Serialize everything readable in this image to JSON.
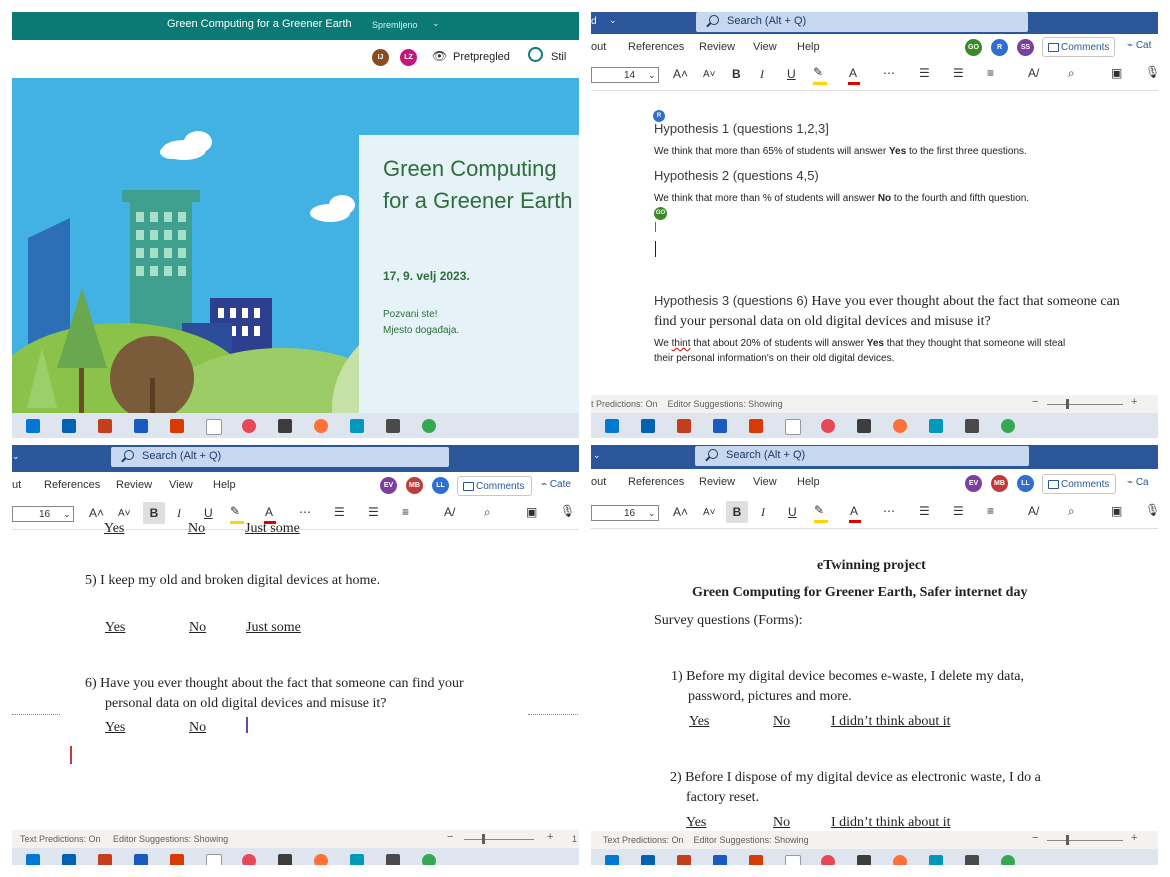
{
  "q1": {
    "header": {
      "title": "Green Computing for a Greener Earth",
      "status": "Spremljeno",
      "avatars": [
        "IJ",
        "LZ"
      ],
      "preview": "Pretpregled",
      "style": "Stil"
    },
    "card": {
      "title": "Green Computing for a Greener Earth",
      "date": "17, 9. velj 2023.",
      "invite": "Pozvani ste!",
      "place": "Mjesto događaja."
    },
    "colors": {
      "header": "#0b7a75",
      "sky": "#42b1e3",
      "card": "#e5f3f9"
    }
  },
  "q2": {
    "search": "Search (Alt + Q)",
    "menu": [
      "out",
      "References",
      "Review",
      "View",
      "Help"
    ],
    "avatars": [
      "GO",
      "R",
      "SS"
    ],
    "comments": "Comments",
    "extra": "Cat",
    "font_size": "14",
    "doc": {
      "h1": "Hypothesis 1 (questions 1,2,3]",
      "p1_pre": "We think that more than 65% of students will answer ",
      "p1_bold": "Yes",
      "p1_post": " to the first three questions.",
      "h2": "Hypothesis 2 (questions 4,5)",
      "p2_pre": "We think that more than % of students will answer ",
      "p2_bold": "No",
      "p2_post": " to the fourth and fifth question.",
      "h3_a": "Hypothesis 3 (questions 6) ",
      "h3_b": "Have you ever thought about the fact that someone can",
      "h3_c": "find your personal data on old digital devices and misuse it?",
      "p3_a_pre": "We ",
      "p3_a_err": "thint",
      "p3_a_post": " that about 20% of students will answer ",
      "p3_a_bold": "Yes",
      "p3_a_end": " that they thought that someone will steal",
      "p3_b": "their personal information's on their old digital devices."
    },
    "status": "t Predictions: On    Editor Suggestions: Showing"
  },
  "q3": {
    "search": "Search (Alt + Q)",
    "menu": [
      "ut",
      "References",
      "Review",
      "View",
      "Help"
    ],
    "avatars": [
      "EV",
      "MB",
      "LL"
    ],
    "comments": "Comments",
    "extra": "Cate",
    "font_size": "16",
    "doc": {
      "cut": [
        "Yes",
        "No",
        "Just some"
      ],
      "q5": "5) I keep my old and broken digital devices at home.",
      "q5_answers": [
        "Yes",
        "No",
        "Just some"
      ],
      "q6_a": "6) Have you ever thought about the fact that someone can find your",
      "q6_b": "personal data on old digital devices and misuse it?",
      "q6_answers": [
        "Yes",
        "No"
      ]
    },
    "status": "Text Predictions: On     Editor Suggestions: Showing",
    "status_right": "1"
  },
  "q4": {
    "search": "Search (Alt + Q)",
    "menu": [
      "out",
      "References",
      "Review",
      "View",
      "Help"
    ],
    "avatars": [
      "EV",
      "MB",
      "LL"
    ],
    "comments": "Comments",
    "extra": "Ca",
    "font_size": "16",
    "doc": {
      "title": "eTwinning project",
      "subtitle": "Green Computing for Greener Earth, Safer internet day",
      "survey": "Survey questions (Forms):",
      "q1_a": "1) Before my digital device becomes e-waste, I delete my data,",
      "q1_b": "password, pictures and more.",
      "q1_answers": [
        "Yes",
        "No",
        "I didn’t think about it"
      ],
      "q2_a": "2) Before I dispose of my digital device as electronic waste, I do a",
      "q2_b": "factory reset.",
      "q2_answers": [
        "Yes",
        "No",
        "I didn’t think about it"
      ]
    },
    "status": "Text Predictions: On    Editor Suggestions: Showing"
  },
  "word_blue": "#2b579a",
  "taskbar_icons": [
    "windows-icon",
    "mail-icon",
    "powerpoint-icon",
    "word-icon",
    "office-icon",
    "note-icon",
    "drop-icon",
    "tablet-icon",
    "firefox-icon",
    "photos-icon",
    "camera-icon",
    "chrome-icon"
  ]
}
